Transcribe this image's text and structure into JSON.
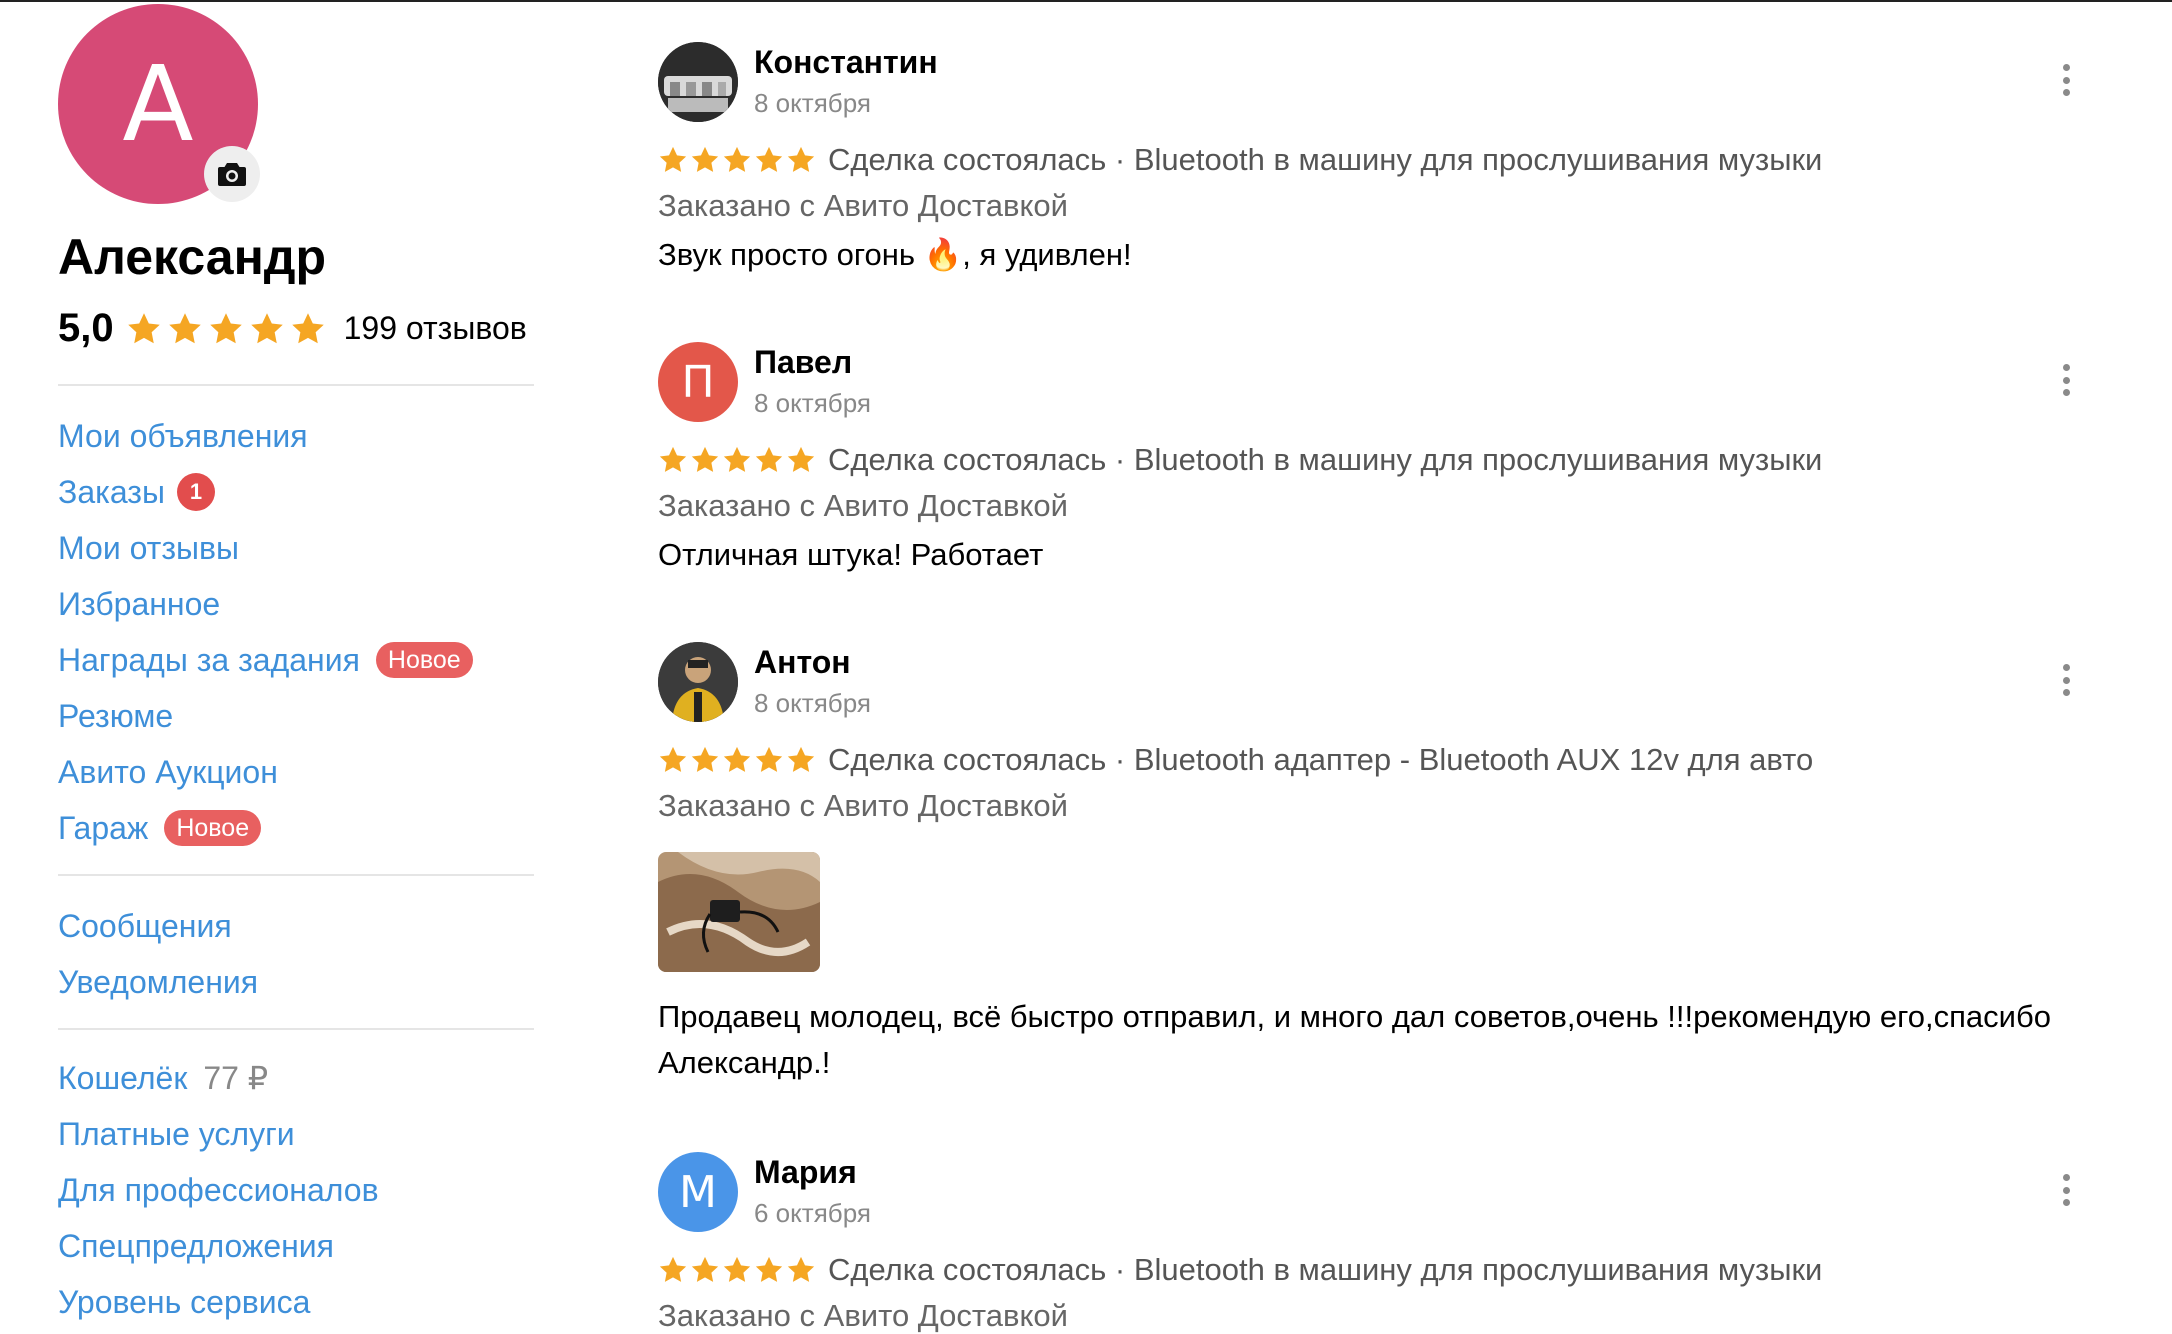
{
  "profile": {
    "avatar_letter": "А",
    "avatar_color": "#d64a76",
    "camera_icon": "camera-icon",
    "name": "Александр",
    "rating": "5,0",
    "reviews_count": "199 отзывов",
    "rating_stars": 5
  },
  "nav_primary": [
    {
      "label": "Мои объявления"
    },
    {
      "label": "Заказы",
      "badge": "1"
    },
    {
      "label": "Мои отзывы"
    },
    {
      "label": "Избранное"
    },
    {
      "label": "Награды за задания",
      "tag": "Новое"
    },
    {
      "label": "Резюме"
    },
    {
      "label": "Авито Аукцион"
    },
    {
      "label": "Гараж",
      "tag": "Новое"
    }
  ],
  "nav_secondary": [
    {
      "label": "Сообщения"
    },
    {
      "label": "Уведомления"
    }
  ],
  "nav_tertiary": [
    {
      "label": "Кошелёк",
      "amount": "77 ₽"
    },
    {
      "label": "Платные услуги"
    },
    {
      "label": "Для профессионалов"
    },
    {
      "label": "Спецпредложения"
    },
    {
      "label": "Уровень сервиса"
    }
  ],
  "reviews": [
    {
      "name": "Константин",
      "date": "8 октября",
      "avatar_type": "photo",
      "stars": 5,
      "deal": "Сделка состоялась · Bluetooth в машину для прослушивания музыки",
      "delivery": "Заказано с Авито Доставкой",
      "text": "Звук просто огонь 🔥, я удивлен!"
    },
    {
      "name": "Павел",
      "date": "8 октября",
      "avatar_type": "letter",
      "avatar_letter": "П",
      "avatar_color": "#e3574a",
      "stars": 5,
      "deal": "Сделка состоялась · Bluetooth в машину для прослушивания музыки",
      "delivery": "Заказано с Авито Доставкой",
      "text": "Отличная штука! Работает"
    },
    {
      "name": "Антон",
      "date": "8 октября",
      "avatar_type": "photo",
      "stars": 5,
      "deal": "Сделка состоялась · Bluetooth адаптер - Bluetooth AUX 12v для авто",
      "delivery": "Заказано с Авито Доставкой",
      "has_photo": true,
      "text": "Продавец молодец, всё быстро отправил, и много дал советов,очень !!!рекомендую его,спасибо Александр.!"
    },
    {
      "name": "Мария",
      "date": "6 октября",
      "avatar_type": "letter",
      "avatar_letter": "М",
      "avatar_color": "#4a95e8",
      "stars": 5,
      "deal": "Сделка состоялась · Bluetooth в машину для прослушивания музыки",
      "delivery": "Заказано с Авито Доставкой",
      "text": ""
    }
  ],
  "colors": {
    "link": "#3e8fd9",
    "star": "#f5a623",
    "badge_red": "#e24d4d"
  }
}
